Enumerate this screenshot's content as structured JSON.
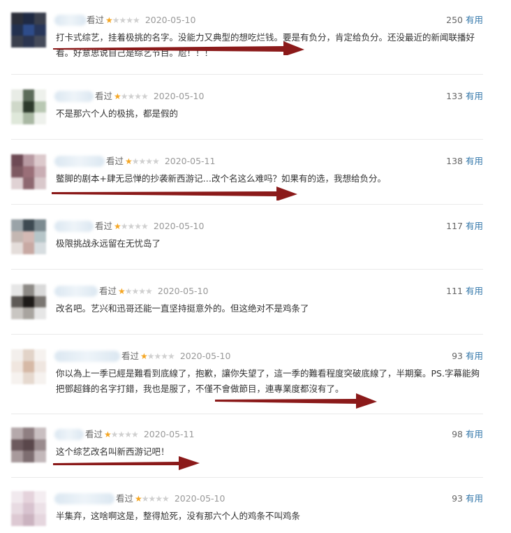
{
  "review_label": "看过",
  "useful_label": "有用",
  "colors": {
    "star_on": "#f5a623",
    "star_off": "#d0d0d0",
    "link": "#3377aa",
    "arrow": "#8b1a1a"
  },
  "reviews": [
    {
      "rating": 1,
      "date": "2020-05-10",
      "count": "250",
      "text": "打卡式综艺，挂着极挑的名字。没能力又典型的想吃烂钱。要是有负分，肯定给负分。还没最近的新闻联播好看。好意思说自己是综艺节目。尬！！！"
    },
    {
      "rating": 1,
      "date": "2020-05-10",
      "count": "133",
      "text": "不是那六个人的极挑，都是假的"
    },
    {
      "rating": 1,
      "date": "2020-05-11",
      "count": "138",
      "text": "鳖脚的剧本+肆无忌惮的抄袭新西游记…改个名这么难吗？如果有的选，我想给负分。"
    },
    {
      "rating": 1,
      "date": "2020-05-10",
      "count": "117",
      "text": "极限挑战永远留在无忧岛了"
    },
    {
      "rating": 1,
      "date": "2020-05-10",
      "count": "111",
      "text": "改名吧。艺兴和迅哥还能一直坚持挺意外的。但这绝对不是鸡条了"
    },
    {
      "rating": 1,
      "date": "2020-05-10",
      "count": "93",
      "text": "你以為上一季已經是難看到底線了，抱歉，讓你失望了，這一季的難看程度突破底線了，半期棄。PS.字幕能夠把鄧超鋒的名字打錯，我也是服了，不僅不會做節目，連專業度都沒有了。"
    },
    {
      "rating": 1,
      "date": "2020-05-11",
      "count": "98",
      "text": "这个综艺改名叫新西游记吧！"
    },
    {
      "rating": 1,
      "date": "2020-05-10",
      "count": "93",
      "text": "半集弃，这啥啊这是，整得尬死，没有那六个人的鸡条不叫鸡条"
    }
  ]
}
